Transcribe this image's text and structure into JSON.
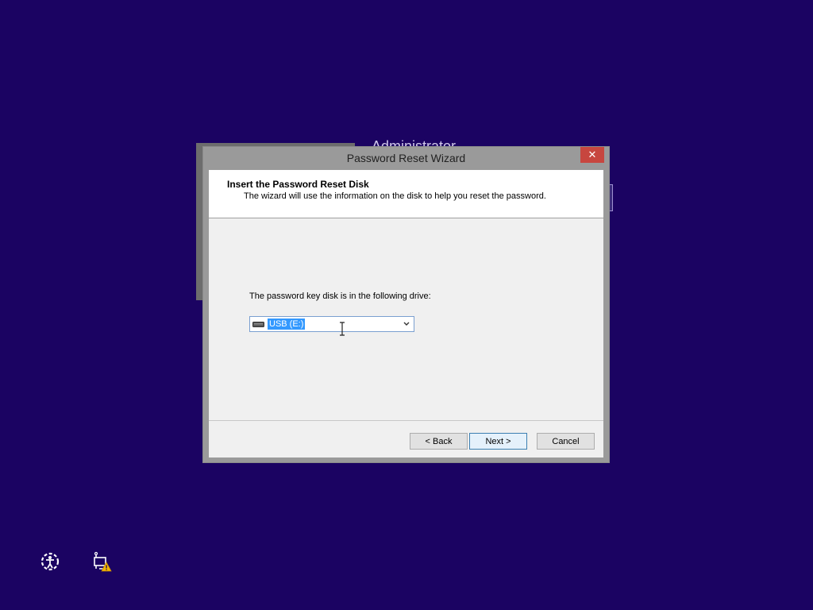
{
  "background": {
    "color": "#1b0362",
    "user_name_partial": "Administrator"
  },
  "dialog": {
    "title": "Password Reset Wizard",
    "close_glyph": "✕",
    "header": {
      "title": "Insert the Password Reset Disk",
      "subtitle": "The wizard will use the information on the disk to help you reset the password."
    },
    "drive_label": "The password key disk is in the following drive:",
    "drive_select": {
      "selected": "USB (E:)",
      "icon": "usb-drive-icon"
    },
    "buttons": {
      "back": "< Back",
      "next": "Next >",
      "cancel": "Cancel"
    }
  },
  "taskbar_icons": {
    "ease_of_access": "ease-of-access-icon",
    "network": "network-warning-icon"
  },
  "colors": {
    "close": "#c7463f",
    "selection": "#3399ff",
    "warning": "#f5b800"
  }
}
